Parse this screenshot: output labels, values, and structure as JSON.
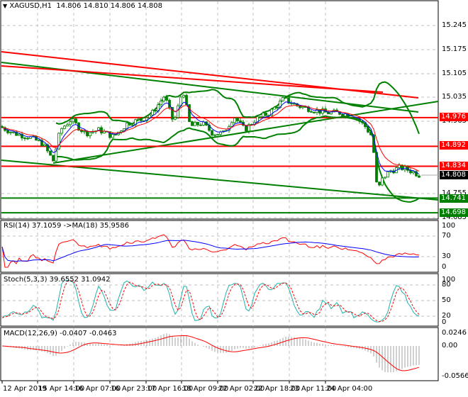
{
  "header": {
    "symbol": "XAGUSD,H1",
    "open": "14.806",
    "high": "14.810",
    "low": "14.806",
    "close": "14.808",
    "menu_icon": "triangle-down-icon"
  },
  "price_axis": {
    "ticks": [
      "15.245",
      "15.175",
      "15.105",
      "15.035",
      "14.965",
      "14.755",
      "14.685"
    ]
  },
  "levels": [
    {
      "value": "14.976",
      "color": "#ff0000"
    },
    {
      "value": "14.892",
      "color": "#ff0000"
    },
    {
      "value": "14.834",
      "color": "#ff0000"
    },
    {
      "value": "14.741",
      "color": "#008000"
    },
    {
      "value": "14.698",
      "color": "#008000"
    }
  ],
  "current_price": {
    "value": "14.808",
    "color": "#000000"
  },
  "rsi": {
    "label": "RSI(14) 37.1059 ->MA(18) 35.9586",
    "ticks": [
      "100",
      "70",
      "30",
      "0"
    ]
  },
  "stoch": {
    "label": "Stoch(5,3,3) 39.6552 31.0942",
    "ticks": [
      "100",
      "80",
      "50",
      "20",
      "0"
    ]
  },
  "macd": {
    "label": "MACD(12,26,9) -0.0407 -0.0463",
    "ticks": [
      "0.0246",
      "0.00",
      "-0.0566"
    ]
  },
  "time_axis": [
    "12 Apr 2019",
    "15 Apr 14:00",
    "16 Apr 07:00",
    "16 Apr 23:00",
    "17 Apr 16:00",
    "18 Apr 09:00",
    "22 Apr 02:00",
    "22 Apr 18:00",
    "23 Apr 11:00",
    "24 Apr 04:00"
  ],
  "chart_data": {
    "type": "candlestick",
    "title": "XAGUSD,H1",
    "ylim": [
      14.685,
      15.28
    ],
    "colors": {
      "bull": "#008000",
      "bear": "#008000",
      "ma_fast": "#0000ff",
      "ma_slow": "#ff0000",
      "bands": "#008000"
    },
    "approx_close_path": [
      [
        0,
        14.95
      ],
      [
        20,
        14.93
      ],
      [
        40,
        14.92
      ],
      [
        60,
        14.9
      ],
      [
        75,
        14.85
      ],
      [
        85,
        14.94
      ],
      [
        100,
        14.97
      ],
      [
        120,
        14.93
      ],
      [
        140,
        14.94
      ],
      [
        160,
        14.92
      ],
      [
        180,
        14.96
      ],
      [
        200,
        14.97
      ],
      [
        215,
        14.99
      ],
      [
        232,
        15.04
      ],
      [
        245,
        14.96
      ],
      [
        258,
        15.06
      ],
      [
        268,
        14.95
      ],
      [
        285,
        14.96
      ],
      [
        300,
        14.93
      ],
      [
        315,
        14.93
      ],
      [
        330,
        14.98
      ],
      [
        345,
        14.94
      ],
      [
        360,
        14.97
      ],
      [
        380,
        14.99
      ],
      [
        400,
        15.03
      ],
      [
        420,
        15.01
      ],
      [
        440,
        15.0
      ],
      [
        460,
        14.99
      ],
      [
        480,
        14.99
      ],
      [
        500,
        14.98
      ],
      [
        515,
        14.95
      ],
      [
        525,
        14.92
      ],
      [
        532,
        14.76
      ],
      [
        540,
        14.8
      ],
      [
        550,
        14.82
      ],
      [
        565,
        14.83
      ],
      [
        580,
        14.82
      ],
      [
        592,
        14.808
      ]
    ]
  }
}
